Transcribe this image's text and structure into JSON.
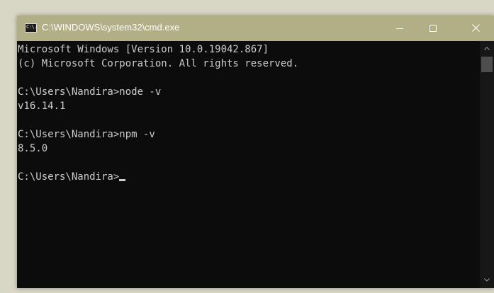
{
  "window": {
    "title": "C:\\WINDOWS\\system32\\cmd.exe",
    "icon": "cmd-icon",
    "icon_glyph": "C:\\.",
    "controls": {
      "minimize": "minimize-icon",
      "maximize": "maximize-icon",
      "close": "close-icon"
    }
  },
  "console": {
    "lines": [
      "Microsoft Windows [Version 10.0.19042.867]",
      "(c) Microsoft Corporation. All rights reserved.",
      "",
      "C:\\Users\\Nandira>node -v",
      "v16.14.1",
      "",
      "C:\\Users\\Nandira>npm -v",
      "8.5.0",
      "",
      "C:\\Users\\Nandira>"
    ],
    "colors": {
      "background": "#0c0c0c",
      "foreground": "#cccccc",
      "titlebar": "#b2ae86"
    }
  }
}
